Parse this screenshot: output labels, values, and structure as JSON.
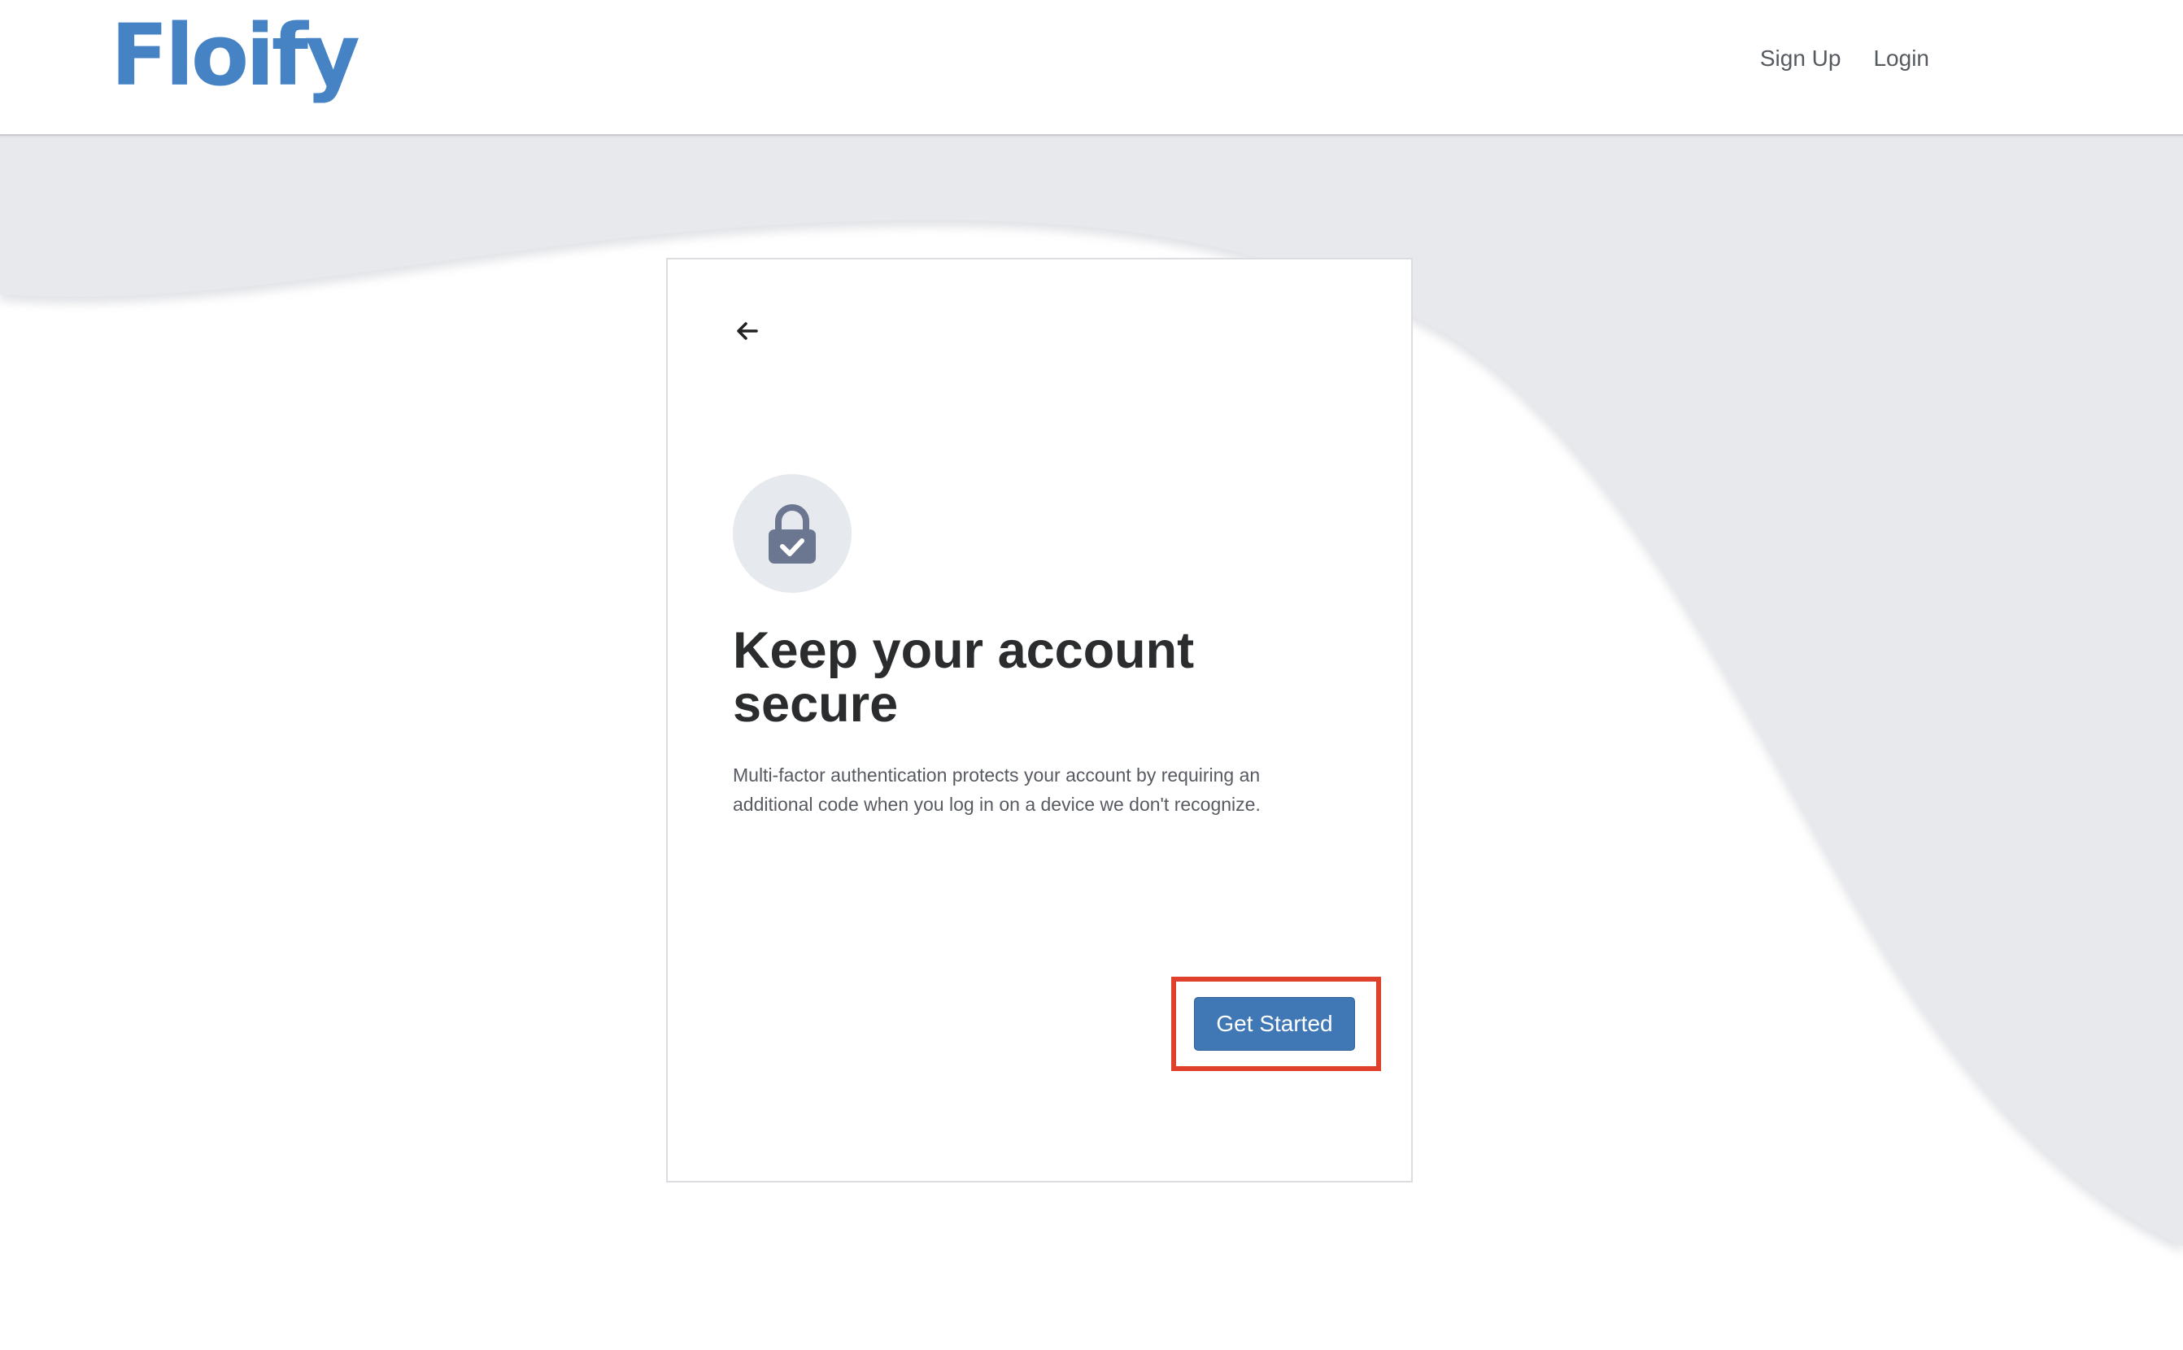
{
  "header": {
    "logo_text": "Floify",
    "nav": {
      "signup_label": "Sign Up",
      "login_label": "Login"
    }
  },
  "card": {
    "back_icon": "arrow-left-icon",
    "lock_icon": "lock-check-icon",
    "title": "Keep your account secure",
    "description": "Multi-factor authentication protects your account by requiring an additional code when you log in on a device we don't recognize.",
    "cta_label": "Get Started"
  },
  "colors": {
    "brand": "#4583c4",
    "button": "#4077b5",
    "highlight": "#e0412d",
    "background_band": "#e8e9ec",
    "lock_circle": "#e6e9ed",
    "lock_icon": "#6b7791"
  }
}
